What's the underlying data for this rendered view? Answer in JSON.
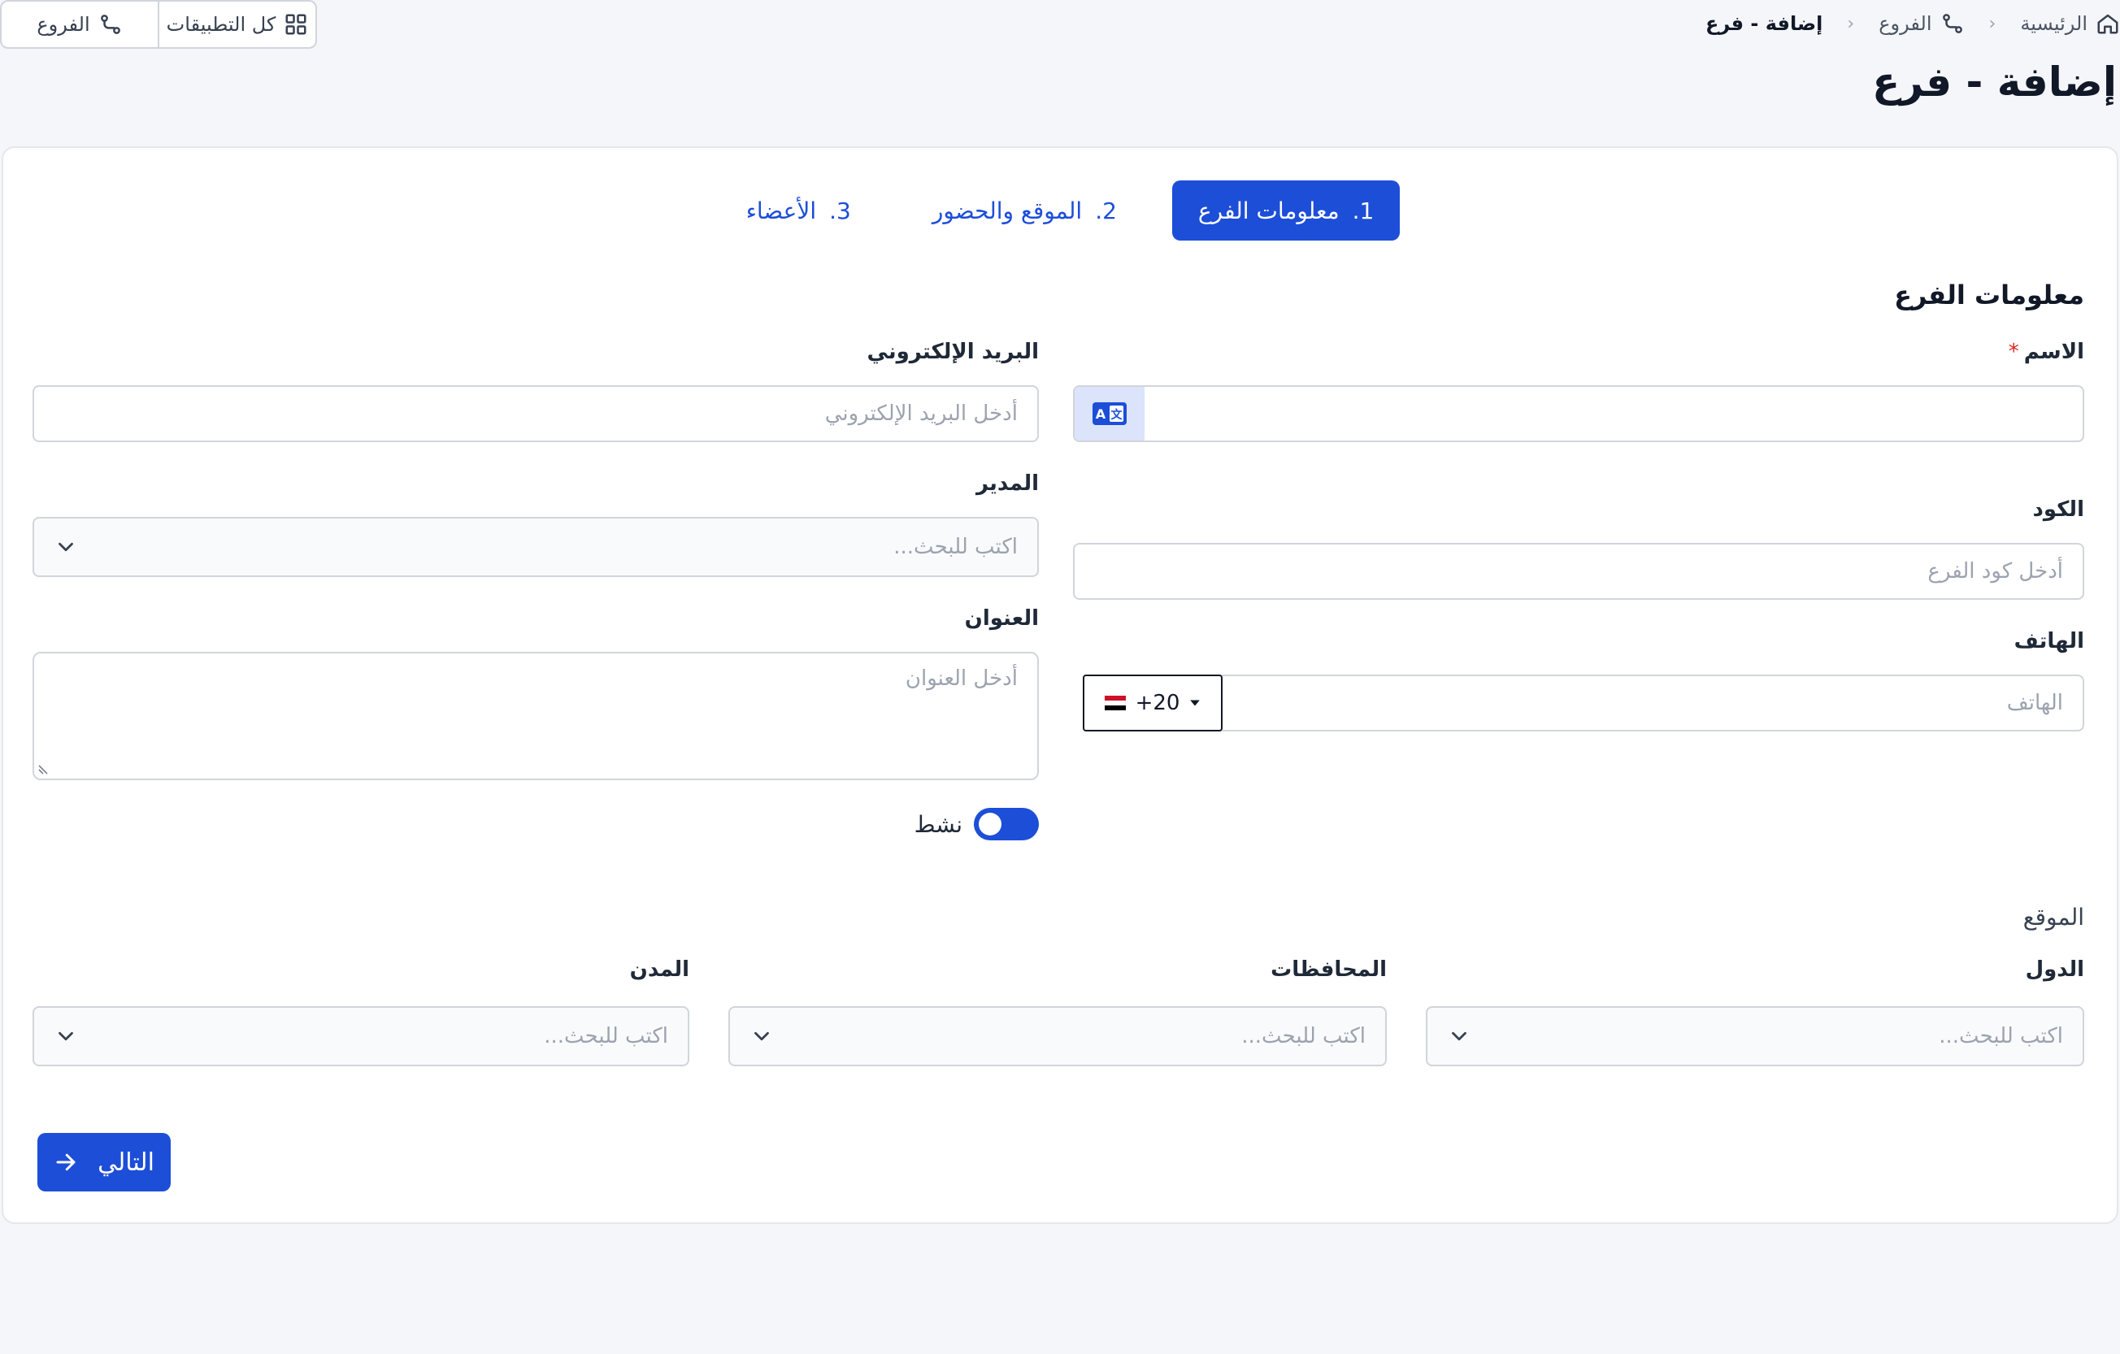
{
  "breadcrumb": {
    "home": "الرئيسية",
    "branches": "الفروع",
    "current": "إضافة - فرع"
  },
  "top_actions": {
    "all_apps": "كل التطبيقات",
    "branches": "الفروع"
  },
  "page_title": "إضافة - فرع",
  "stepper": {
    "steps": [
      {
        "number": "1.",
        "label": "معلومات الفرع",
        "active": true
      },
      {
        "number": "2.",
        "label": "الموقع والحضور",
        "active": false
      },
      {
        "number": "3.",
        "label": "الأعضاء",
        "active": false
      }
    ]
  },
  "branch_info": {
    "section_title": "معلومات الفرع",
    "name": {
      "label": "الاسم",
      "required_mark": "*",
      "value": ""
    },
    "email": {
      "label": "البريد الإلكتروني",
      "placeholder": "أدخل البريد الإلكتروني"
    },
    "code": {
      "label": "الكود",
      "placeholder": "أدخل كود الفرع"
    },
    "manager": {
      "label": "المدير",
      "placeholder": "اكتب للبحث..."
    },
    "phone": {
      "label": "الهاتف",
      "placeholder": "الهاتف",
      "country_code": "+20"
    },
    "address": {
      "label": "العنوان",
      "placeholder": "أدخل العنوان"
    },
    "active": {
      "label": "نشط",
      "on": true
    }
  },
  "location": {
    "section_title": "الموقع",
    "countries": {
      "label": "الدول",
      "placeholder": "اكتب للبحث..."
    },
    "governorates": {
      "label": "المحافظات",
      "placeholder": "اكتب للبحث..."
    },
    "cities": {
      "label": "المدن",
      "placeholder": "اكتب للبحث..."
    }
  },
  "next_button": "التالي",
  "colors": {
    "primary": "#1d4ed8",
    "background": "#f5f6fa",
    "border": "#d1d5db",
    "required": "#dc2626"
  }
}
